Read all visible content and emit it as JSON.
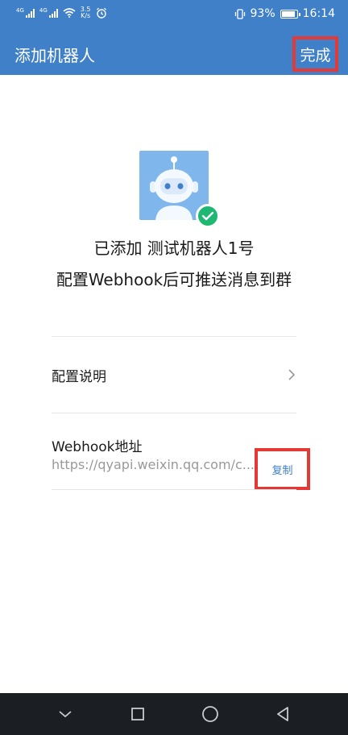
{
  "status_bar": {
    "net1": "4G",
    "net2": "4G",
    "speed_value": "3.5",
    "speed_unit": "K/s",
    "battery_percent": "93%",
    "time": "16:14"
  },
  "header": {
    "title": "添加机器人",
    "done_label": "完成"
  },
  "content": {
    "added_message": "已添加 测试机器人1号",
    "hint_message": "配置Webhook后可推送消息到群",
    "config_label": "配置说明",
    "webhook_title": "Webhook地址",
    "webhook_url": "https://qyapi.weixin.qq.com/c...",
    "copy_label": "复制"
  },
  "colors": {
    "header_bg": "#3f80c8",
    "avatar_bg": "#7fb6ec",
    "check_green": "#1fb873",
    "link_blue": "#3f80c8",
    "highlight_red": "#e53935",
    "navbar_bg": "#1b1f24"
  },
  "icons": {
    "chevron": "chevron-right-icon",
    "nav": [
      "chevron-down-icon",
      "square-icon",
      "circle-icon",
      "back-triangle-icon"
    ]
  }
}
